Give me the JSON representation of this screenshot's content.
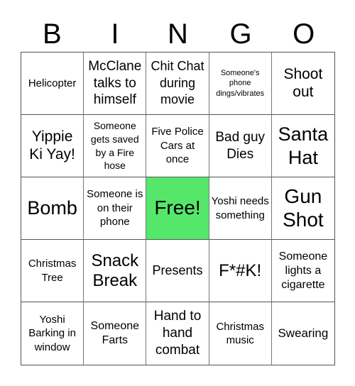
{
  "header": {
    "letters": [
      "B",
      "I",
      "N",
      "G",
      "O"
    ]
  },
  "colors": {
    "free_cell": "#55e76a",
    "grid_line": "#555555"
  },
  "board": {
    "rows": [
      [
        "Helicopter",
        "McClane talks to himself",
        "Chit Chat during movie",
        "Someone's phone dings/vibrates",
        "Shoot out"
      ],
      [
        "Yippie Ki Yay!",
        "Someone gets saved by a Fire hose",
        "Five Police Cars at once",
        "Bad guy Dies",
        "Santa Hat"
      ],
      [
        "Bomb",
        "Someone is on their phone",
        "Free!",
        "Yoshi needs something",
        "Gun Shot"
      ],
      [
        "Christmas Tree",
        "Snack Break",
        "Presents",
        "F*#K!",
        "Someone lights a cigarette"
      ],
      [
        "Yoshi Barking in window",
        "Someone Farts",
        "Hand to hand combat",
        "Christmas music",
        "Swearing"
      ]
    ],
    "free_cell": {
      "row": 2,
      "col": 2
    }
  }
}
